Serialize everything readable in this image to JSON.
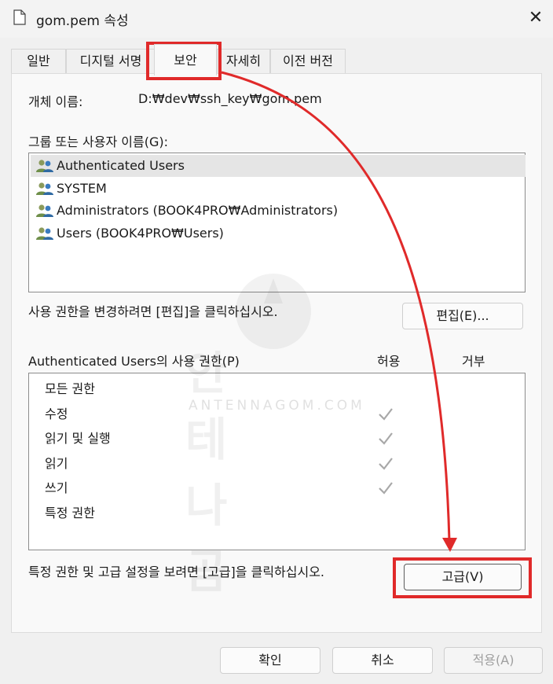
{
  "window": {
    "title": "gom.pem 속성",
    "close_glyph": "✕"
  },
  "tabs": [
    {
      "label": "일반"
    },
    {
      "label": "디지털 서명"
    },
    {
      "label": "보안"
    },
    {
      "label": "자세히"
    },
    {
      "label": "이전 버전"
    }
  ],
  "security": {
    "object_name_label": "개체 이름:",
    "object_name_value": "D:₩dev₩ssh_key₩gom.pem",
    "groups_label": "그룹 또는 사용자 이름(G):",
    "users": [
      {
        "name": "Authenticated Users",
        "selected": true
      },
      {
        "name": "SYSTEM",
        "selected": false
      },
      {
        "name": "Administrators (BOOK4PRO₩Administrators)",
        "selected": false
      },
      {
        "name": "Users (BOOK4PRO₩Users)",
        "selected": false
      }
    ],
    "edit_hint": "사용 권한을 변경하려면 [편집]을 클릭하십시오.",
    "edit_button": "편집(E)...",
    "permissions_label": "Authenticated Users의 사용 권한(P)",
    "allow_header": "허용",
    "deny_header": "거부",
    "permissions": [
      {
        "name": "모든 권한",
        "allow": false,
        "deny": false
      },
      {
        "name": "수정",
        "allow": true,
        "deny": false
      },
      {
        "name": "읽기 및 실행",
        "allow": true,
        "deny": false
      },
      {
        "name": "읽기",
        "allow": true,
        "deny": false
      },
      {
        "name": "쓰기",
        "allow": true,
        "deny": false
      },
      {
        "name": "특정 권한",
        "allow": false,
        "deny": false
      }
    ],
    "advanced_hint": "특정 권한 및 고급 설정을 보려면 [고급]을 클릭하십시오.",
    "advanced_button": "고급(V)"
  },
  "footer": {
    "ok": "확인",
    "cancel": "취소",
    "apply": "적용(A)"
  },
  "watermark": {
    "text": "안테나곰",
    "subtext": "ANTENNAGOM.COM"
  },
  "colors": {
    "annotation_red": "#e02a2a",
    "check_gray": "#a8a8a8"
  }
}
